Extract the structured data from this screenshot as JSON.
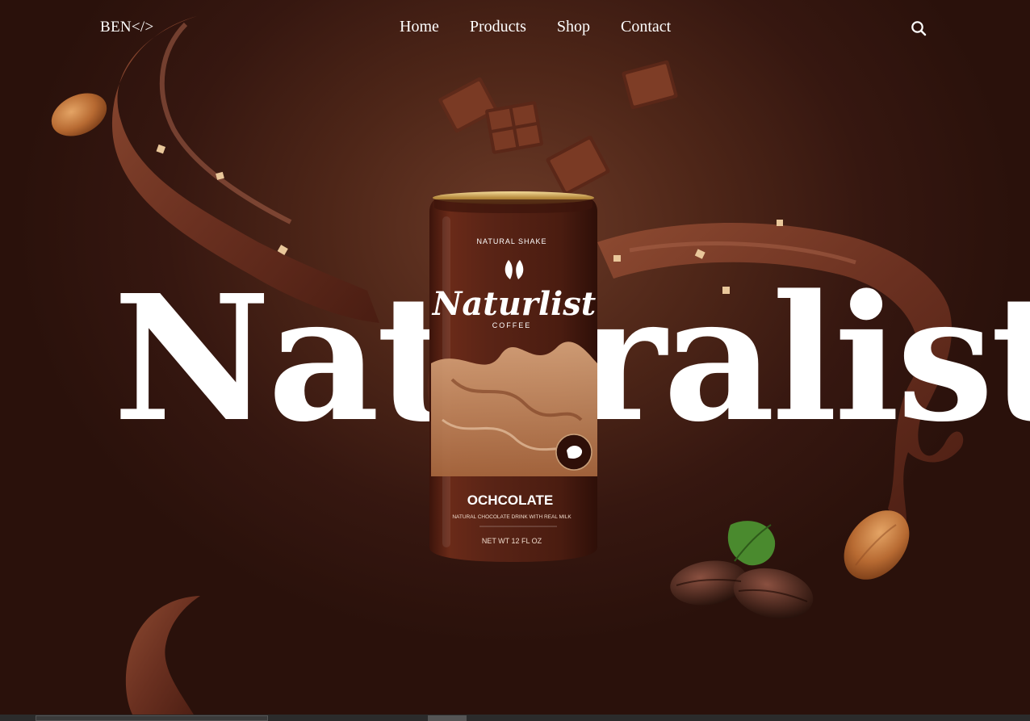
{
  "nav": {
    "logo": "BEN</>",
    "items": [
      "Home",
      "Products",
      "Shop",
      "Contact"
    ],
    "search_icon": "search-icon"
  },
  "hero": {
    "headline": "Naturalist"
  },
  "product": {
    "brand": "Naturlist",
    "tagline": "COFFEE",
    "top_text": "NATURAL SHAKE",
    "flavor": "OCHCOLATE",
    "small_text": "NATURAL CHOCOLATE DRINK WITH REAL MILK",
    "bottom_text": "NET WT 12 FL OZ"
  },
  "colors": {
    "background": "#4e2618",
    "accent": "#8a4a2e",
    "can": "#5a2416",
    "text": "#ffffff"
  }
}
